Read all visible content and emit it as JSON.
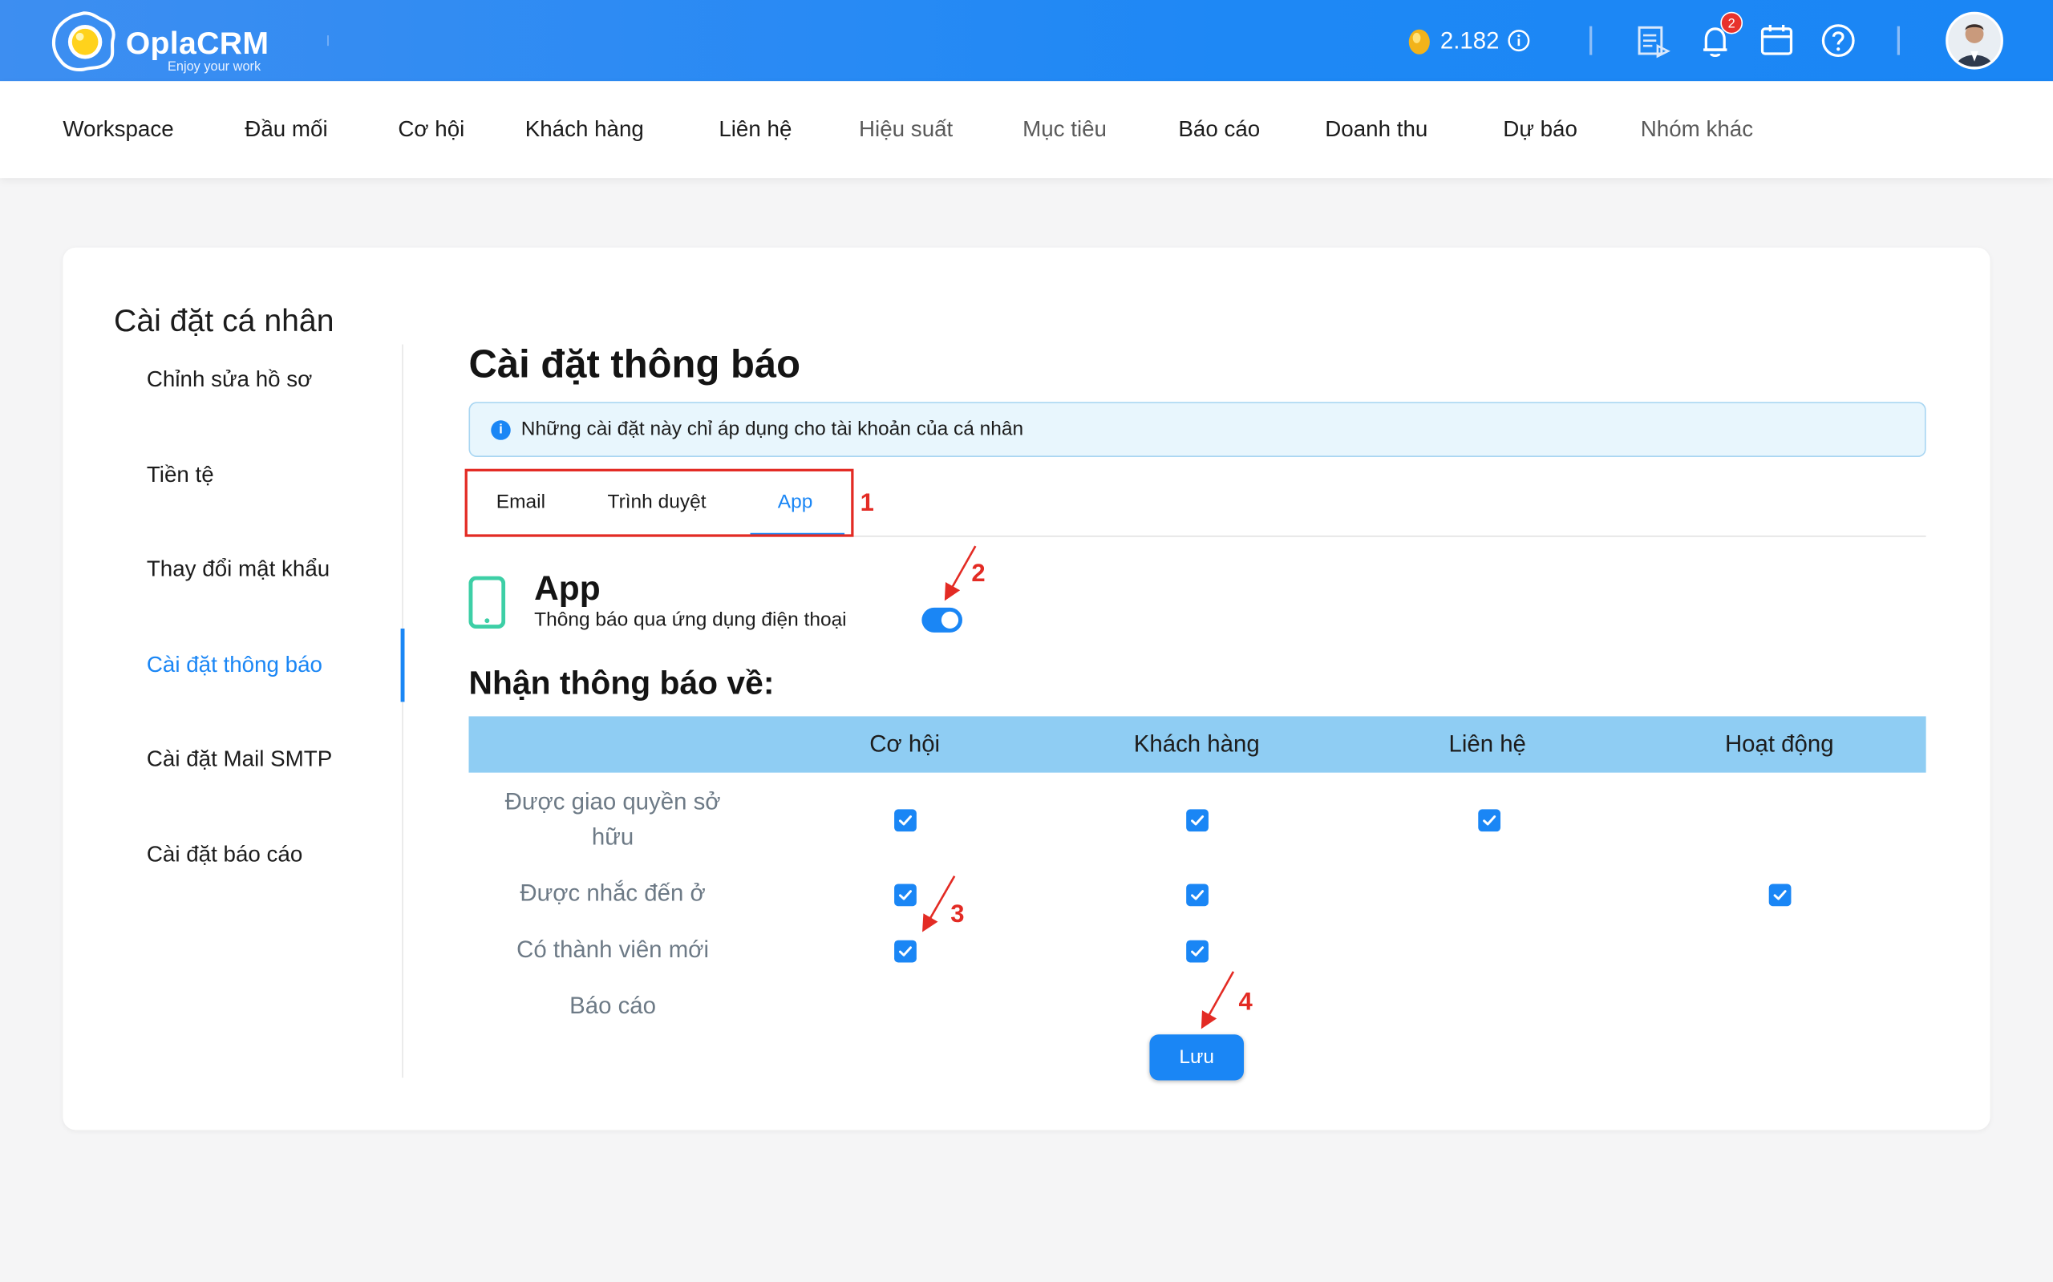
{
  "header": {
    "logo_text": "OplaCRM",
    "logo_tagline": "Enjoy your work",
    "coins": "2.182",
    "notification_count": "2"
  },
  "nav": {
    "items": [
      "Workspace",
      "Đầu mối",
      "Cơ hội",
      "Khách hàng",
      "Liên hệ",
      "Hiệu suất",
      "Mục tiêu",
      "Báo cáo",
      "Doanh thu",
      "Dự báo",
      "Nhóm khác"
    ]
  },
  "sidebar": {
    "title": "Cài đặt cá nhân",
    "items": [
      "Chỉnh sửa hồ sơ",
      "Tiền tệ",
      "Thay đổi mật khẩu",
      "Cài đặt thông báo",
      "Cài đặt Mail SMTP",
      "Cài đặt báo cáo"
    ],
    "active": "Cài đặt thông báo"
  },
  "main": {
    "title": "Cài đặt thông báo",
    "info": "Những cài đặt này chỉ áp dụng cho tài khoản của cá nhân",
    "tabs": [
      "Email",
      "Trình duyệt",
      "App"
    ],
    "active_tab": "App",
    "app_title": "App",
    "app_subtitle": "Thông báo qua ứng dụng điện thoại",
    "app_enabled": true,
    "section_title": "Nhận thông báo về:",
    "columns": [
      "Cơ hội",
      "Khách hàng",
      "Liên hệ",
      "Hoạt động"
    ],
    "rows": [
      {
        "label": "Được giao quyền sở hữu",
        "checks": [
          true,
          true,
          true,
          false
        ]
      },
      {
        "label": "Được nhắc đến ở",
        "checks": [
          true,
          true,
          false,
          true
        ]
      },
      {
        "label": "Có thành viên mới",
        "checks": [
          true,
          true,
          false,
          false
        ]
      },
      {
        "label": "Báo cáo",
        "checks": [
          false,
          false,
          false,
          false
        ]
      }
    ],
    "save_label": "Lưu"
  },
  "annotations": [
    "1",
    "2",
    "3",
    "4"
  ],
  "colors": {
    "primary": "#1a86f5",
    "header": "#1e88f5",
    "table_header": "#8fcdf3",
    "annotation": "#e32b24"
  },
  "icons": [
    "egg-coin-icon",
    "info-icon",
    "report-icon",
    "bell-icon",
    "calendar-icon",
    "help-icon",
    "phone-icon",
    "check-icon"
  ]
}
